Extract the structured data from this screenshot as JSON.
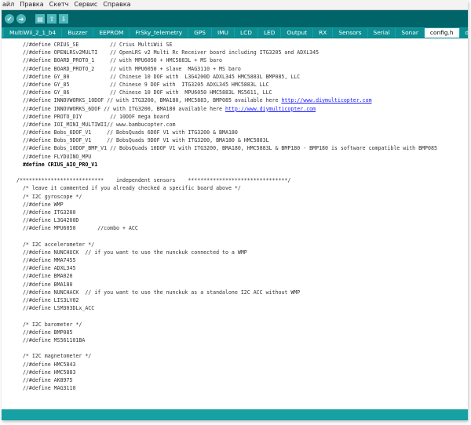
{
  "menu": [
    "айл",
    "Правка",
    "Скетч",
    "Сервис",
    "Справка"
  ],
  "toolbar": {
    "verify_icon": "check-icon",
    "upload_icon": "arrow-right-icon",
    "new_icon": "new-file-icon",
    "open_icon": "up-arrow-icon",
    "save_icon": "down-arrow-icon",
    "glyphs": {
      "verify": "✔",
      "upload": "➔",
      "new": "▤",
      "open": "⇧",
      "save": "⇩"
    }
  },
  "tabs": [
    "MultiWii_2_1_b4",
    "Buzzer",
    "EEPROM",
    "FrSky_telemetry",
    "GPS",
    "IMU",
    "LCD",
    "LED",
    "Output",
    "RX",
    "Sensors",
    "Serial",
    "Sonar",
    "config.h",
    "def.h"
  ],
  "active_tab": "config.h",
  "code_lines": [
    "  //#define CRIUS_SE          // Crius MultiWii SE",
    "  //#define OPENLRSv2MULTI    // OpenLRS v2 Multi Rc Receiver board including ITG3205 and ADXL345",
    "  //#define BOARD_PROTO_1     // with MPU6050 + HMC5883L + MS baro",
    "  //#define BOARD_PROTO_2     // with MPU6050 + slave  MAG3110 + MS baro",
    "  //#define GY_80             // Chinese 10 DOF with  L3G4200D ADXL345 HMC5883L BMP085, LLC",
    "  //#define GY_85             // Chinese 9 DOF with  ITG3205 ADXL345 HMC5883L LLC",
    "  //#define GY_86             // Chinese 10 DOF with  MPU6050 HMC5883L MS5611, LLC",
    "  //#define INNOVWORKS_10DOF // with ITG3200, BMA180, HMC5883, BMP085 available here ",
    "  //#define INNOVWORKS_6DOF // with ITG3200, BMA180 available here ",
    "  //#define PROTO_DIY         // 10DOF mega board",
    "  //#define IOI_MINI_MULTIWII// www.bambucopter.com",
    "  //#define Bobs_6DOF_V1     // BobsQuads 6DOF V1 with ITG3200 & BMA180",
    "  //#define Bobs_9DOF_V1     // BobsQuads 9DOF V1 with ITG3200, BMA180 & HMC5883L",
    "  //#define Bobs_10DOF_BMP_V1 // BobsQuads 10DOF V1 with ITG3200, BMA180, HMC5883L & BMP180 - BMP180 is software compatible with BMP085",
    "  //#define FLYDUINO_MPU",
    "  #define CRIUS_AIO_PRO_V1",
    "",
    "/***************************    independent sensors    ********************************/",
    "  /* leave it commented if you already checked a specific board above */",
    "  /* I2C gyroscope */",
    "  //#define WMP",
    "  //#define ITG3200",
    "  //#define L3G4200D",
    "  //#define MPU6050       //combo + ACC",
    "",
    "  /* I2C accelerometer */",
    "  //#define NUNCHUCK  // if you want to use the nunckuk connected to a WMP",
    "  //#define MMA7455",
    "  //#define ADXL345",
    "  //#define BMA020",
    "  //#define BMA180",
    "  //#define NUNCHACK  // if you want to use the nunckuk as a standalone I2C ACC without WMP",
    "  //#define LIS3LV02",
    "  //#define LSM303DLx_ACC",
    "",
    "  /* I2C barometer */",
    "  //#define BMP085",
    "  //#define MS561101BA",
    "",
    "  /* I2C magnetometer */",
    "  //#define HMC5843",
    "  //#define HMC5883",
    "  //#define AK8975",
    "  //#define MAG3110"
  ],
  "links": {
    "7": "http://www.diymulticopter.com",
    "8": "http://www.diymulticopter.com"
  },
  "bold_line": 15,
  "colors": {
    "toolbar": "#006468",
    "tabbar": "#17a1a5",
    "tab": "#0d8e92",
    "button": "#4db7bb",
    "link": "#1a1aff"
  }
}
